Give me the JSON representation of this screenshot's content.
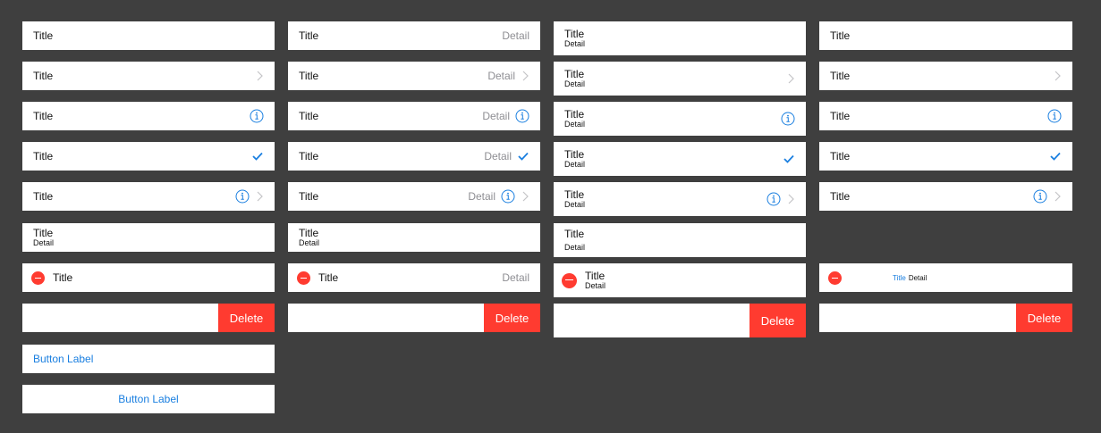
{
  "labels": {
    "title": "Title",
    "detail": "Detail",
    "delete": "Delete",
    "button_label": "Button Label"
  },
  "colors": {
    "background": "#3f3f3f",
    "cell": "#ffffff",
    "tint": "#1a7fe0",
    "destructive": "#ff3b30",
    "detail_gray": "#8e8e93"
  },
  "icons": [
    "chevron-right-icon",
    "info-icon",
    "checkmark-icon",
    "minus-circle-icon"
  ]
}
